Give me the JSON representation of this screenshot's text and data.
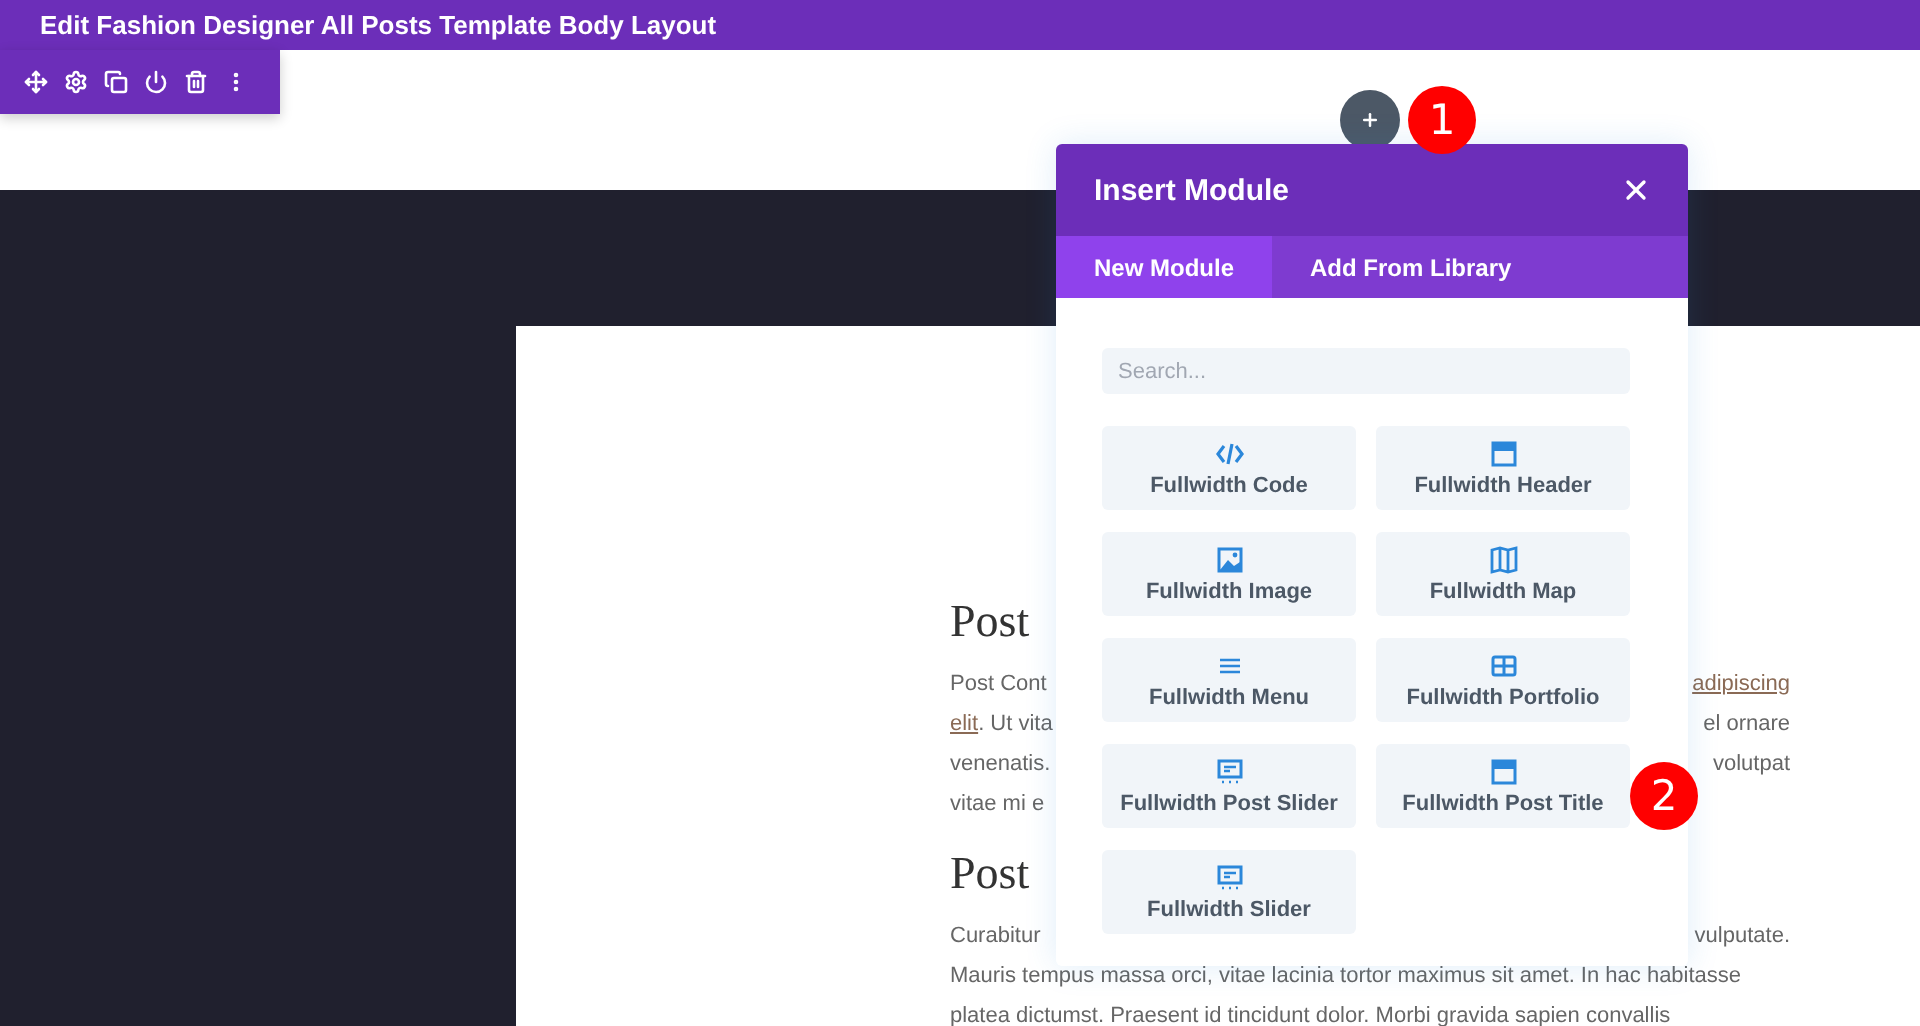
{
  "title_bar": {
    "title": "Edit Fashion Designer All Posts Template Body Layout"
  },
  "badges": [
    {
      "label": "1",
      "kind": "add"
    },
    {
      "label": "2",
      "kind": "module"
    }
  ],
  "modal": {
    "title": "Insert Module",
    "tabs": [
      {
        "label": "New Module",
        "selected": true
      },
      {
        "label": "Add From Library",
        "selected": false
      }
    ],
    "search": {
      "placeholder": "Search..."
    },
    "modules": [
      {
        "label": "Fullwidth Code",
        "kind": "code"
      },
      {
        "label": "Fullwidth Header",
        "kind": "header"
      },
      {
        "label": "Fullwidth Image",
        "kind": "image"
      },
      {
        "label": "Fullwidth Map",
        "kind": "map"
      },
      {
        "label": "Fullwidth Menu",
        "kind": "menu"
      },
      {
        "label": "Fullwidth Portfolio",
        "kind": "portfolio"
      },
      {
        "label": "Fullwidth Post Slider",
        "kind": "slider"
      },
      {
        "label": "Fullwidth Post Title",
        "kind": "header"
      },
      {
        "label": "Fullwidth Slider",
        "kind": "slider"
      }
    ]
  },
  "post": {
    "sections": [
      {
        "heading": "Post",
        "lines": [
          {
            "left": [
              {
                "kind": "text",
                "text": "Post Cont"
              }
            ],
            "right": [
              {
                "kind": "link",
                "text": "adipiscing"
              }
            ]
          },
          {
            "left": [
              {
                "kind": "link",
                "text": "elit"
              },
              {
                "kind": "text",
                "text": ". Ut vita"
              }
            ],
            "right": [
              {
                "kind": "text",
                "text": "el ornare"
              }
            ]
          },
          {
            "left": [
              {
                "kind": "text",
                "text": "venenatis."
              }
            ],
            "right": [
              {
                "kind": "text",
                "text": "volutpat"
              }
            ]
          },
          {
            "left": [
              {
                "kind": "text",
                "text": "vitae mi e"
              }
            ]
          }
        ]
      },
      {
        "heading": "Post",
        "lines": [
          {
            "left": [
              {
                "kind": "text",
                "text": "Curabitur"
              }
            ],
            "right": [
              {
                "kind": "text",
                "text": "vulputate."
              }
            ]
          },
          {
            "left": [
              {
                "kind": "text",
                "text": "Mauris tempus massa orci, vitae lacinia tortor maximus sit amet. In hac habitasse"
              }
            ]
          },
          {
            "left": [
              {
                "kind": "text",
                "text": "platea dictumst. Praesent id tincidunt dolor. Morbi gravida sapien convallis"
              }
            ]
          }
        ]
      }
    ]
  }
}
